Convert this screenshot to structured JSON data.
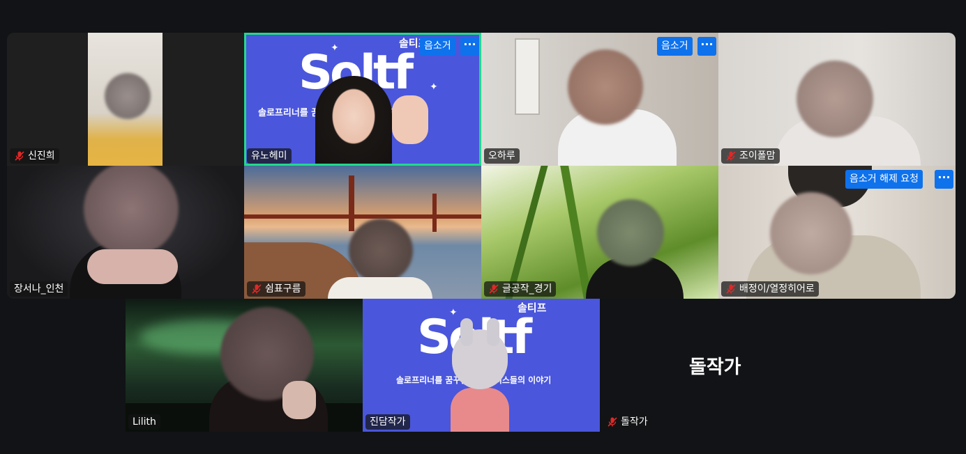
{
  "participants": [
    {
      "name": "신진희",
      "muted": true
    },
    {
      "name": "유노헤미",
      "muted": false
    },
    {
      "name": "오하루",
      "muted": false
    },
    {
      "name": "조이폴맘",
      "muted": true
    },
    {
      "name": "장서나_인천",
      "muted": false
    },
    {
      "name": "쉼표구름",
      "muted": true
    },
    {
      "name": "글공작_경기",
      "muted": true
    },
    {
      "name": "배정이/열정히어로",
      "muted": true
    },
    {
      "name": "Lilith",
      "muted": false
    },
    {
      "name": "진담작가",
      "muted": false
    },
    {
      "name": "돌작가",
      "muted": true
    }
  ],
  "buttons": {
    "mute": "음소거",
    "mute2": "음소거",
    "unmute_request": "음소거 해제 요청",
    "more": "···"
  },
  "brand": {
    "small": "솔티프",
    "logo": "Soltf",
    "subtitle": "솔로프리너를 꿈꾸는 프리랜서스들의 이야기"
  },
  "self_view_name": "돌작가",
  "colors": {
    "active_speaker": "#23d88e",
    "button_blue": "#0e72ed",
    "brand_bg": "#4a56db"
  }
}
